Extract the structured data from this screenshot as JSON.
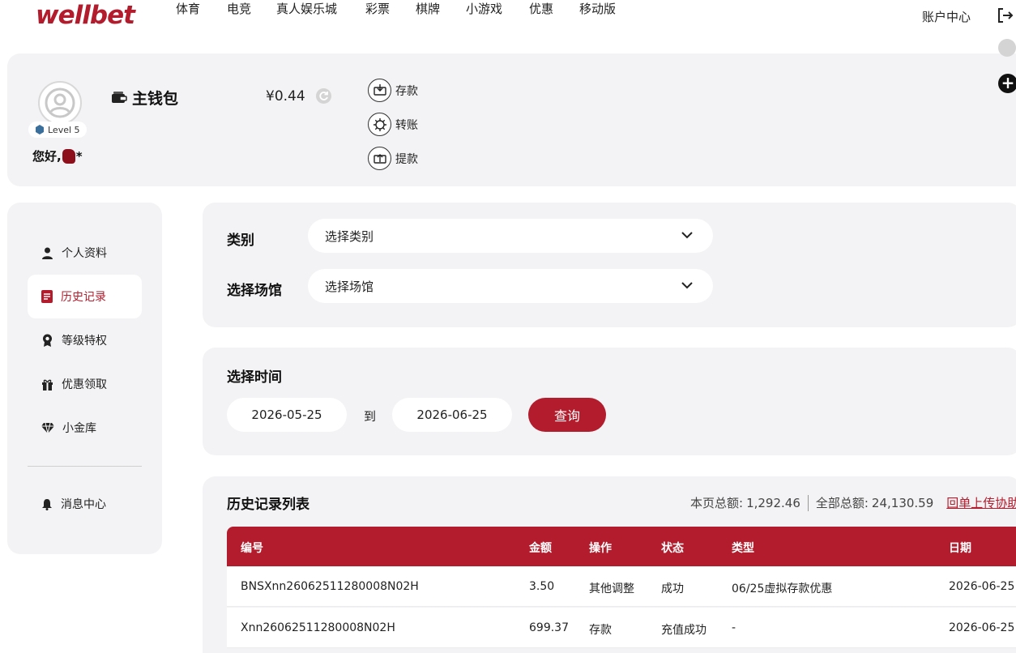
{
  "header": {
    "logo": "wellbet",
    "nav": [
      "体育",
      "电竞",
      "真人娱乐城",
      "彩票",
      "棋牌",
      "小游戏",
      "优惠",
      "移动版"
    ],
    "account_label": "账户中心"
  },
  "wallet": {
    "level": "Level 5",
    "greeting": "您好,",
    "greeting_suffix": "*",
    "title": "主钱包",
    "balance": "¥0.44",
    "actions": [
      "存款",
      "转账",
      "提款"
    ]
  },
  "sidebar": {
    "items": [
      {
        "label": "个人资料",
        "icon": "user-icon"
      },
      {
        "label": "历史记录",
        "icon": "document-icon"
      },
      {
        "label": "等级特权",
        "icon": "badge-icon"
      },
      {
        "label": "优惠领取",
        "icon": "gift-icon"
      },
      {
        "label": "小金库",
        "icon": "diamond-icon"
      },
      {
        "label": "消息中心",
        "icon": "bell-icon"
      }
    ]
  },
  "filters": {
    "category_label": "类别",
    "category_value": "选择类别",
    "venue_label": "选择场馆",
    "venue_value": "选择场馆"
  },
  "date_range": {
    "title": "选择时间",
    "start": "2026-05-25",
    "to": "到",
    "end": "2026-06-25",
    "query_label": "查询"
  },
  "history": {
    "title": "历史记录列表",
    "page_total_label": "本页总额:",
    "page_total": "1,292.46",
    "all_total_label": "全部总额:",
    "all_total": "24,130.59",
    "link_text": "回单上传协助",
    "columns": [
      "编号",
      "金额",
      "操作",
      "状态",
      "类型",
      "日期"
    ],
    "rows": [
      [
        "BNSXnn26062511280008N02H",
        "3.50",
        "其他调整",
        "成功",
        "06/25虚拟存款优惠",
        "2026-06-25"
      ],
      [
        "Xnn26062511280008N02H",
        "699.37",
        "存款",
        "充值成功",
        "-",
        "2026-06-25"
      ]
    ]
  },
  "colors": {
    "brand": "#b21c2c",
    "panel": "#f3f3f5"
  }
}
